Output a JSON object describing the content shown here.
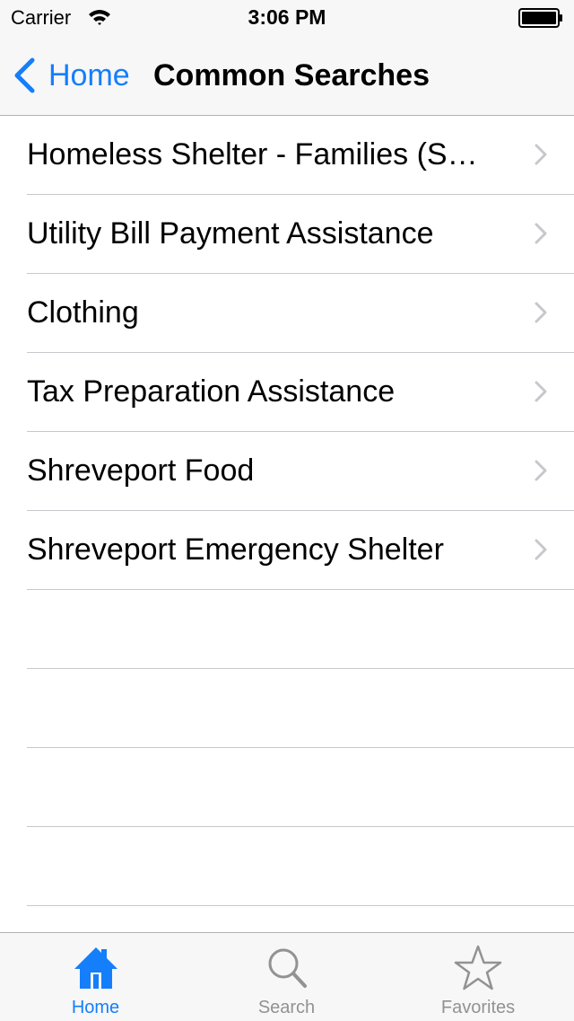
{
  "status_bar": {
    "carrier": "Carrier",
    "time": "3:06 PM"
  },
  "nav_bar": {
    "back_label": "Home",
    "title": "Common Searches"
  },
  "list": {
    "items": [
      {
        "label": "Homeless Shelter - Families (S…"
      },
      {
        "label": "Utility Bill Payment Assistance"
      },
      {
        "label": "Clothing"
      },
      {
        "label": "Tax Preparation Assistance"
      },
      {
        "label": "Shreveport Food"
      },
      {
        "label": "Shreveport Emergency Shelter"
      }
    ]
  },
  "tab_bar": {
    "tabs": [
      {
        "label": "Home",
        "icon": "house-icon",
        "active": true
      },
      {
        "label": "Search",
        "icon": "magnifier-icon",
        "active": false
      },
      {
        "label": "Favorites",
        "icon": "star-icon",
        "active": false
      }
    ]
  },
  "colors": {
    "accent": "#157efb",
    "inactive_tab": "#929292",
    "bar_background": "#f7f7f7",
    "separator": "#c8c7cc",
    "chevron": "#c7c7cc"
  }
}
